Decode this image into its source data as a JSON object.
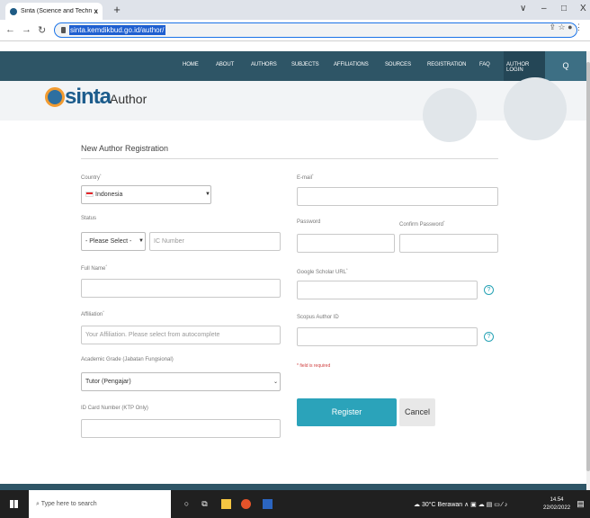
{
  "browser": {
    "tab_title": "Sinta (Science and Technology In",
    "tab_close": "x",
    "new_tab": "+",
    "url": "sinta.kemdikbud.go.id/author/",
    "controls": {
      "min": "–",
      "max": "□",
      "close": "X",
      "chev": "∨"
    }
  },
  "nav": {
    "items": [
      "HOME",
      "ABOUT",
      "AUTHORS",
      "SUBJECTS",
      "AFFILIATIONS",
      "SOURCES",
      "REGISTRATION",
      "FAQ"
    ],
    "login": "AUTHOR LOGIN",
    "search": "Q"
  },
  "header": {
    "logo": "sinta",
    "title": "Author"
  },
  "form": {
    "title": "New Author Registration",
    "country_label": "Country",
    "country_value": "Indonesia",
    "status_label": "Status",
    "status_value": "- Please Select -",
    "ic_placeholder": "IC Number",
    "fullname_label": "Full Name",
    "affiliation_label": "Affiliation",
    "affiliation_placeholder": "Your Affiliation. Please select from autocomplete",
    "grade_label": "Academic Grade (Jabatan Fungsional)",
    "grade_value": "Tutor (Pengajar)",
    "idcard_label": "ID Card Number (KTP Only)",
    "email_label": "E-mail",
    "password_label": "Password",
    "confirm_label": "Confirm Password",
    "scholar_label": "Google Scholar URL",
    "scopus_label": "Scopus Author ID",
    "required_note": "* field is required",
    "register": "Register",
    "cancel": "Cancel",
    "req_mark": "*",
    "help": "?"
  },
  "taskbar": {
    "search": "Type here to search",
    "weather": "30°C Berawan",
    "time": "14.54",
    "date": "22/02/2022"
  }
}
